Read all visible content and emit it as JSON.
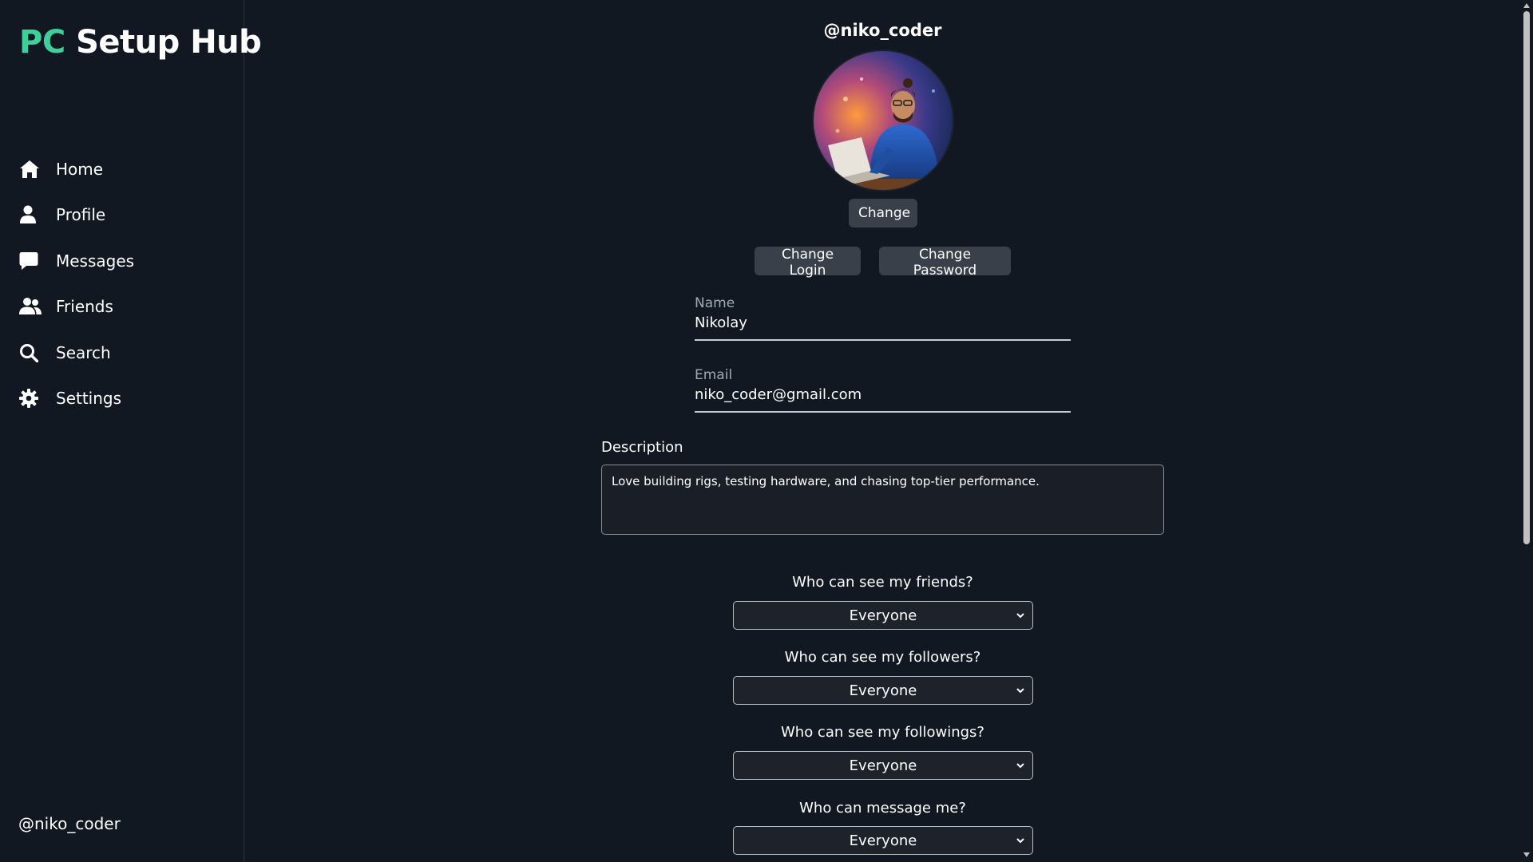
{
  "app": {
    "logo_prefix": "PC",
    "logo_rest": " Setup Hub"
  },
  "sidebar": {
    "items": [
      {
        "label": "Home",
        "icon": "home-icon"
      },
      {
        "label": "Profile",
        "icon": "user-icon"
      },
      {
        "label": "Messages",
        "icon": "chat-bubble-icon"
      },
      {
        "label": "Friends",
        "icon": "users-icon"
      },
      {
        "label": "Search",
        "icon": "search-icon"
      },
      {
        "label": "Settings",
        "icon": "gear-icon"
      }
    ],
    "current_user": "@niko_coder"
  },
  "profile": {
    "username": "@niko_coder",
    "avatar_icon": "avatar-illustration",
    "change_avatar_label": "Change",
    "change_login_label": "Change Login",
    "change_password_label": "Change Password",
    "name_label": "Name",
    "name_value": "Nikolay",
    "email_label": "Email",
    "email_value": "niko_coder@gmail.com",
    "description_label": "Description",
    "description_value": "Love building rigs, testing hardware, and chasing top-tier performance."
  },
  "privacy": [
    {
      "question": "Who can see my friends?",
      "selected": "Everyone"
    },
    {
      "question": "Who can see my followers?",
      "selected": "Everyone"
    },
    {
      "question": "Who can see my followings?",
      "selected": "Everyone"
    },
    {
      "question": "Who can message me?",
      "selected": "Everyone"
    }
  ],
  "colors": {
    "background": "#121821",
    "accent": "#3ecf9a",
    "button": "#3a4049"
  }
}
